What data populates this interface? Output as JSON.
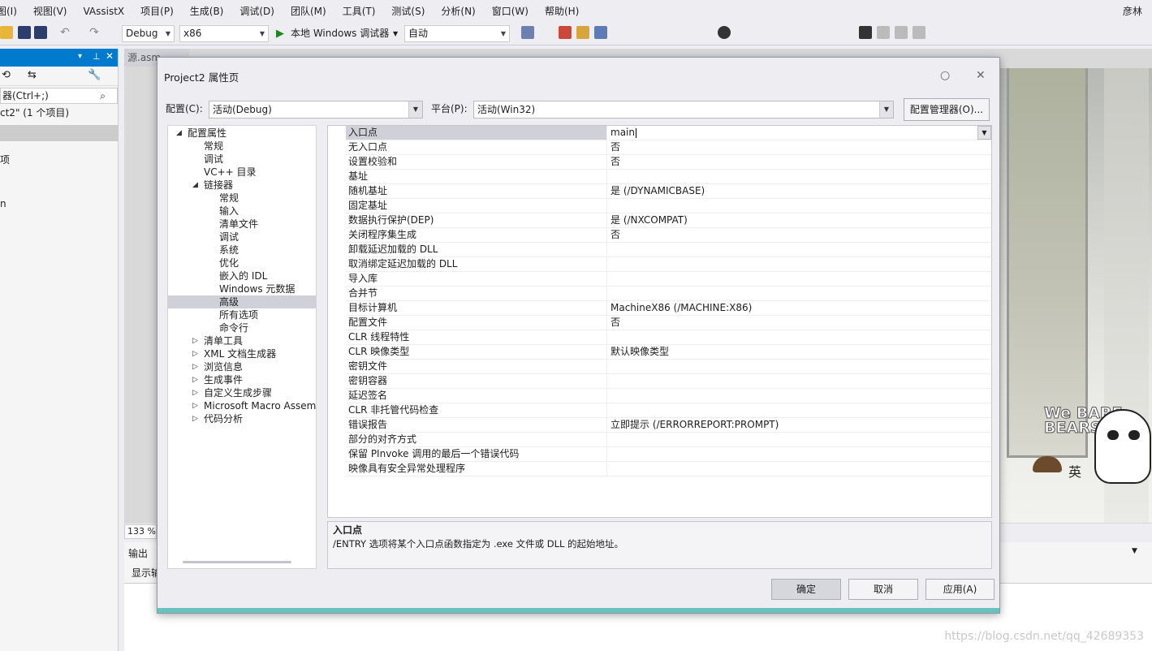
{
  "menubar": {
    "items": [
      "图(I)",
      "视图(V)",
      "VAssistX",
      "项目(P)",
      "生成(B)",
      "调试(D)",
      "团队(M)",
      "工具(T)",
      "测试(S)",
      "分析(N)",
      "窗口(W)",
      "帮助(H)"
    ],
    "user": "彦林"
  },
  "toolbar": {
    "config": "Debug",
    "platform": "x86",
    "run_label": "本地 Windows 调试器",
    "auto": "自动"
  },
  "solution_explorer": {
    "search_placeholder": "器(Ctrl+;)",
    "solution_line": "ct2\" (1 个项目)",
    "item_1": "项",
    "item_2": "n"
  },
  "editor": {
    "tab_label": "源.asm",
    "zoom": "133 %"
  },
  "output": {
    "title": "输出",
    "show_label": "显示输"
  },
  "watermark": "https://blog.csdn.net/qq_42689353",
  "dialog": {
    "title": "Project2 属性页",
    "config_label": "配置(C):",
    "config_value": "活动(Debug)",
    "platform_label": "平台(P):",
    "platform_value": "活动(Win32)",
    "config_manager": "配置管理器(O)...",
    "ok": "确定",
    "cancel": "取消",
    "apply": "应用(A)"
  },
  "tree": [
    {
      "label": "配置属性",
      "level": 0,
      "expander": "open"
    },
    {
      "label": "常规",
      "level": 1,
      "expander": ""
    },
    {
      "label": "调试",
      "level": 1,
      "expander": ""
    },
    {
      "label": "VC++ 目录",
      "level": 1,
      "expander": ""
    },
    {
      "label": "链接器",
      "level": 1,
      "expander": "open"
    },
    {
      "label": "常规",
      "level": 2,
      "expander": ""
    },
    {
      "label": "输入",
      "level": 2,
      "expander": ""
    },
    {
      "label": "清单文件",
      "level": 2,
      "expander": ""
    },
    {
      "label": "调试",
      "level": 2,
      "expander": ""
    },
    {
      "label": "系统",
      "level": 2,
      "expander": ""
    },
    {
      "label": "优化",
      "level": 2,
      "expander": ""
    },
    {
      "label": "嵌入的 IDL",
      "level": 2,
      "expander": ""
    },
    {
      "label": "Windows 元数据",
      "level": 2,
      "expander": ""
    },
    {
      "label": "高级",
      "level": 2,
      "expander": "",
      "selected": true
    },
    {
      "label": "所有选项",
      "level": 2,
      "expander": ""
    },
    {
      "label": "命令行",
      "level": 2,
      "expander": ""
    },
    {
      "label": "清单工具",
      "level": 1,
      "expander": "closed"
    },
    {
      "label": "XML 文档生成器",
      "level": 1,
      "expander": "closed"
    },
    {
      "label": "浏览信息",
      "level": 1,
      "expander": "closed"
    },
    {
      "label": "生成事件",
      "level": 1,
      "expander": "closed"
    },
    {
      "label": "自定义生成步骤",
      "level": 1,
      "expander": "closed"
    },
    {
      "label": "Microsoft Macro Assembler",
      "level": 1,
      "expander": "closed"
    },
    {
      "label": "代码分析",
      "level": 1,
      "expander": "closed"
    }
  ],
  "properties": [
    {
      "name": "入口点",
      "value": "main",
      "selected": true
    },
    {
      "name": "无入口点",
      "value": "否"
    },
    {
      "name": "设置校验和",
      "value": "否"
    },
    {
      "name": "基址",
      "value": ""
    },
    {
      "name": "随机基址",
      "value": "是 (/DYNAMICBASE)"
    },
    {
      "name": "固定基址",
      "value": ""
    },
    {
      "name": "数据执行保护(DEP)",
      "value": "是 (/NXCOMPAT)"
    },
    {
      "name": "关闭程序集生成",
      "value": "否"
    },
    {
      "name": "卸载延迟加载的 DLL",
      "value": ""
    },
    {
      "name": "取消绑定延迟加载的 DLL",
      "value": ""
    },
    {
      "name": "导入库",
      "value": ""
    },
    {
      "name": "合并节",
      "value": ""
    },
    {
      "name": "目标计算机",
      "value": "MachineX86 (/MACHINE:X86)"
    },
    {
      "name": "配置文件",
      "value": "否"
    },
    {
      "name": "CLR 线程特性",
      "value": ""
    },
    {
      "name": "CLR 映像类型",
      "value": "默认映像类型"
    },
    {
      "name": "密钥文件",
      "value": ""
    },
    {
      "name": "密钥容器",
      "value": ""
    },
    {
      "name": "延迟签名",
      "value": ""
    },
    {
      "name": "CLR 非托管代码检查",
      "value": ""
    },
    {
      "name": "错误报告",
      "value": "立即提示 (/ERRORREPORT:PROMPT)"
    },
    {
      "name": "部分的对齐方式",
      "value": ""
    },
    {
      "name": "保留 PInvoke 调用的最后一个错误代码",
      "value": ""
    },
    {
      "name": "映像具有安全异常处理程序",
      "value": ""
    }
  ],
  "description": {
    "title": "入口点",
    "text": "/ENTRY 选项将某个入口点函数指定为 .exe 文件或 DLL 的起始地址。"
  },
  "wallpaper": {
    "brand": "We BARE BEARS",
    "ime": "英"
  }
}
